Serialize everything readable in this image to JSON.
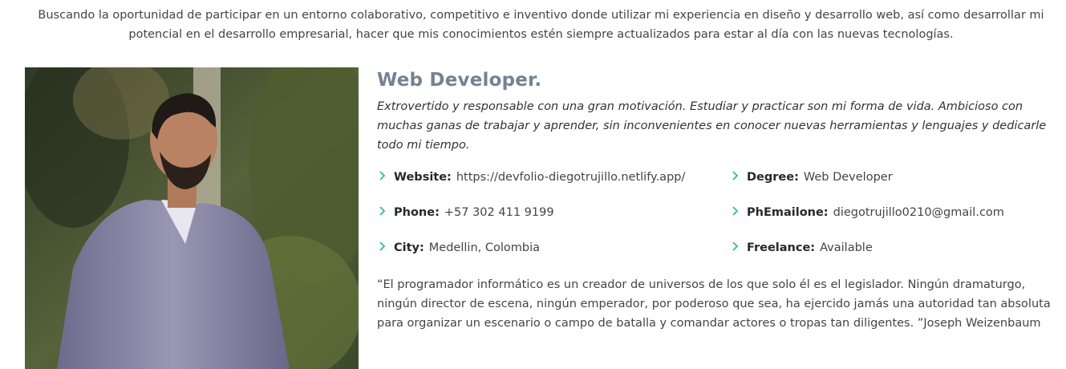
{
  "intro": "Buscando la oportunidad de participar en un entorno colaborativo, competitivo e inventivo donde utilizar mi experiencia en diseño y desarrollo web, así como desarrollar mi potencial en el desarrollo empresarial, hacer que mis conocimientos estén siempre actualizados para estar al día con las nuevas tecnologías.",
  "profile": {
    "role": "Web Developer.",
    "description": "Extrovertido y responsable con una gran motivación. Estudiar y practicar son mi forma de vida. Ambicioso con muchas ganas de trabajar y aprender, sin inconvenientes en conocer nuevas herramientas y lenguajes y dedicarle todo mi tiempo."
  },
  "facts": {
    "website": {
      "label": "Website:",
      "value": "https://devfolio-diegotrujillo.netlify.app/"
    },
    "phone": {
      "label": "Phone:",
      "value": "+57 302 411 9199"
    },
    "city": {
      "label": "City:",
      "value": "Medellin, Colombia"
    },
    "degree": {
      "label": "Degree:",
      "value": "Web Developer"
    },
    "email": {
      "label": "PhEmailone:",
      "value": "diegotrujillo0210@gmail.com"
    },
    "freelance": {
      "label": "Freelance:",
      "value": "Available"
    }
  },
  "quote": "“El programador informático es un creador de universos de los que solo él es el legislador. Ningún dramaturgo, ningún director de escena, ningún emperador, por poderoso que sea, ha ejercido jamás una autoridad tan absoluta para organizar un escenario o campo de batalla y comandar actores o tropas tan diligentes. ”Joseph Weizenbaum",
  "icons": {
    "bullet": "chevron-right-icon"
  },
  "colors": {
    "accent": "#34b7a7",
    "role_heading": "#728394"
  }
}
